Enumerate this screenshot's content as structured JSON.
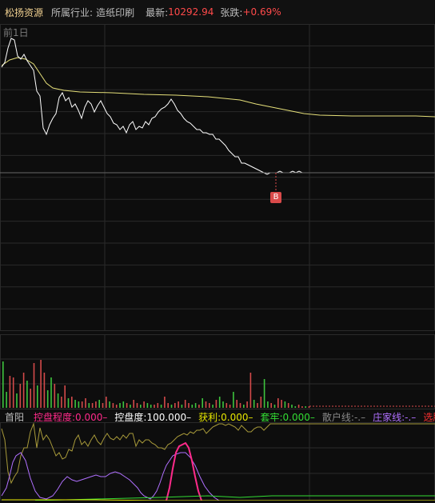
{
  "header": {
    "stock_name": "松扬资源",
    "industry_label": "所属行业:",
    "industry_value": "造纸印刷",
    "latest_label": "最新:",
    "latest_value": "10292.94",
    "change_label": "张跌:",
    "change_value": "+0.69%"
  },
  "main_chart": {
    "period_label": "前1日",
    "marker_label": "B"
  },
  "indicator_legend": {
    "first_label": "首阳",
    "items": [
      {
        "text": "控盘程度:0.000–",
        "color": "#ff2a8a"
      },
      {
        "text": "控盘度:100.000–",
        "color": "#ffffff"
      },
      {
        "text": "获利:0.000–",
        "color": "#e6e600"
      },
      {
        "text": "套牢:0.000–",
        "color": "#33dd33"
      },
      {
        "text": "散户线:-.–",
        "color": "#888888"
      },
      {
        "text": "庄家线:-.–",
        "color": "#b070ff"
      },
      {
        "text": "选股",
        "color": "#ff3030"
      }
    ]
  },
  "colors": {
    "price_line": "#ffffff",
    "avg_line": "#e6e07a",
    "up_bar": "#d44a4a",
    "down_bar": "#3ec43e",
    "grid": "#2a2a2a"
  }
}
